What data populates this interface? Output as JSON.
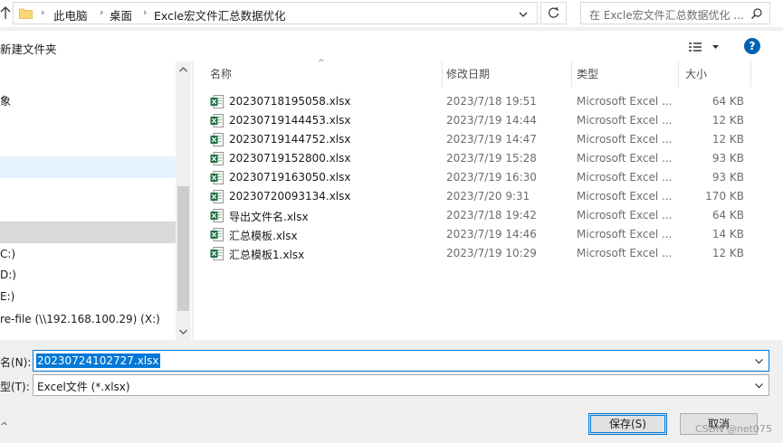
{
  "address_bar": {
    "crumbs": [
      "此电脑",
      "桌面",
      "Excle宏文件汇总数据优化"
    ],
    "search_placeholder": "在 Excle宏文件汇总数据优化 ..."
  },
  "toolbar": {
    "new_folder_label": "新建文件夹",
    "help_label": "?"
  },
  "nav_pane": {
    "items": [
      {
        "label": "象"
      },
      {
        "label": ""
      },
      {
        "label": ""
      },
      {
        "label": ""
      },
      {
        "label": ""
      },
      {
        "label": "C:)"
      },
      {
        "label": "D:)"
      },
      {
        "label": "E:)"
      },
      {
        "label": "re-file (\\\\192.168.100.29) (X:)"
      }
    ]
  },
  "file_list": {
    "columns": {
      "name": "名称",
      "date": "修改日期",
      "type": "类型",
      "size": "大小"
    },
    "rows": [
      {
        "name": "20230718195058.xlsx",
        "date": "2023/7/18 19:51",
        "type": "Microsoft Excel ...",
        "size": "64 KB"
      },
      {
        "name": "20230719144453.xlsx",
        "date": "2023/7/19 14:44",
        "type": "Microsoft Excel ...",
        "size": "12 KB"
      },
      {
        "name": "20230719144752.xlsx",
        "date": "2023/7/19 14:47",
        "type": "Microsoft Excel ...",
        "size": "12 KB"
      },
      {
        "name": "20230719152800.xlsx",
        "date": "2023/7/19 15:28",
        "type": "Microsoft Excel ...",
        "size": "93 KB"
      },
      {
        "name": "20230719163050.xlsx",
        "date": "2023/7/19 16:30",
        "type": "Microsoft Excel ...",
        "size": "93 KB"
      },
      {
        "name": "20230720093134.xlsx",
        "date": "2023/7/20 9:31",
        "type": "Microsoft Excel ...",
        "size": "170 KB"
      },
      {
        "name": "导出文件名.xlsx",
        "date": "2023/7/18 19:42",
        "type": "Microsoft Excel ...",
        "size": "64 KB"
      },
      {
        "name": "汇总模板.xlsx",
        "date": "2023/7/19 14:46",
        "type": "Microsoft Excel ...",
        "size": "14 KB"
      },
      {
        "name": "汇总模板1.xlsx",
        "date": "2023/7/19 10:29",
        "type": "Microsoft Excel ...",
        "size": "12 KB"
      }
    ]
  },
  "bottom": {
    "filename_label": "名(N):",
    "filename_value": "20230724102727.xlsx",
    "filetype_label": "型(T):",
    "filetype_value": "Excel文件 (*.xlsx)",
    "save_label": "保存(S)",
    "cancel_label": "取消",
    "watermark": "CSDN @net075"
  },
  "colors": {
    "accent": "#0078d7",
    "excel_green": "#1d6f42",
    "nav_selected": "#cce8ff",
    "nav_hover": "#d9d9d9"
  }
}
